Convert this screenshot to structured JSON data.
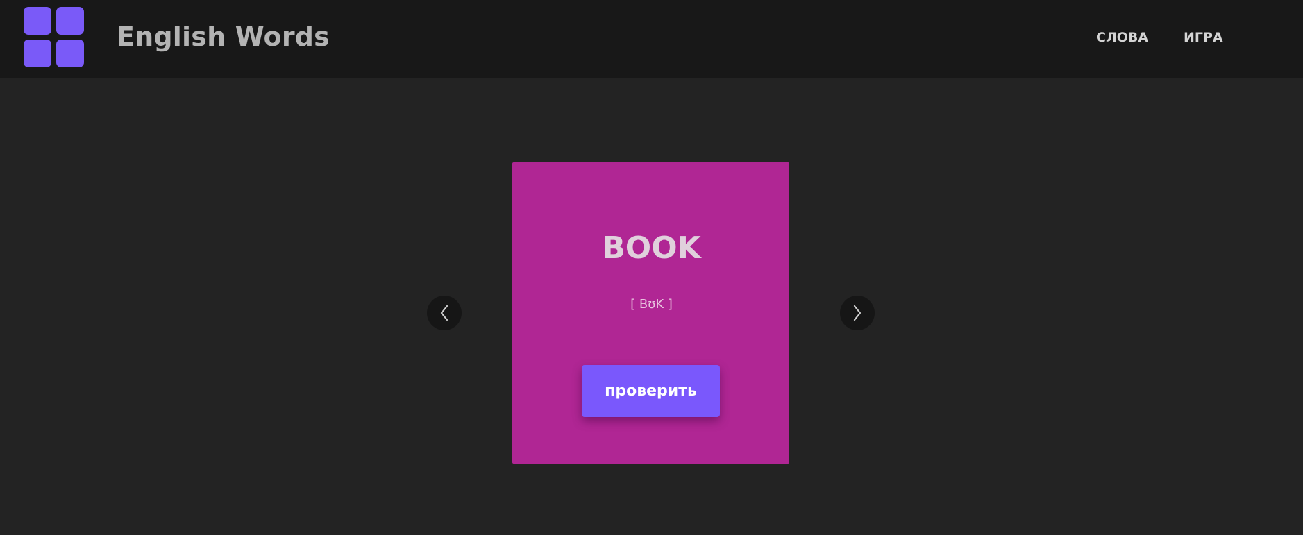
{
  "header": {
    "title": "English Words",
    "nav": {
      "words_label": "СЛОВА",
      "game_label": "ИГРА"
    }
  },
  "card": {
    "word": "BOOK",
    "transcription": "[ BʊK ]",
    "check_label": "проверить"
  },
  "carousel": {
    "prev_icon": "chevron-left-icon",
    "next_icon": "chevron-right-icon"
  },
  "colors": {
    "background": "#232323",
    "header_background": "#181818",
    "logo": "#7a5af8",
    "card": "#b02694",
    "button": "#7a58fc"
  }
}
